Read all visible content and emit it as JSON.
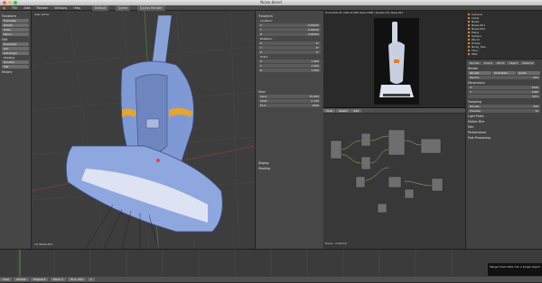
{
  "window": {
    "title": "Noise.blend"
  },
  "menubar": {
    "items": [
      "File",
      "Add",
      "Render",
      "Window",
      "Help"
    ],
    "layout": "Default",
    "scene": "Scene",
    "engine": "Cycles Render"
  },
  "viewport": {
    "label": "User Ortho",
    "object_label": "(1) Noise.001",
    "bottom_left": "Blender Render"
  },
  "toolshelf": {
    "transform_header": "Transform",
    "transform_buttons": [
      "Translate",
      "Rotate",
      "Scale",
      "Mirror"
    ],
    "edit_header": "Edit",
    "edit_buttons": [
      "Duplicate",
      "Join",
      "Set Origin",
      "Shading",
      "Smooth",
      "Flat"
    ],
    "history_header": "History"
  },
  "npanel": {
    "transform_header": "Transform",
    "fields": [
      "Location:",
      "X",
      "Y",
      "Z",
      "Rotation:",
      "X",
      "Y",
      "Z",
      "Scale:",
      "X",
      "Y",
      "Z",
      "Dimensions:",
      "X",
      "Y",
      "Z"
    ],
    "view_header": "View",
    "lens": "Lens:",
    "lens_value": "35.000",
    "clip_start": "0.100",
    "clip_end": "1000",
    "display_header": "Display",
    "shading_header": "Shading"
  },
  "render": {
    "info": "Time:00:01.87 | Mem:6.50M, Peak 6.85M | Sample 2/5 | Noise.001"
  },
  "nodeeditor": {
    "label": "Noise - material"
  },
  "outliner": {
    "items": [
      "Camera",
      "Lamp",
      "Noise",
      "Noise.001",
      "Noise.002",
      "Plane",
      "Sphere",
      "World",
      "Holder",
      "Node_Tree",
      "Floor",
      "Wall"
    ]
  },
  "properties": {
    "tabs": [
      "Render",
      "Scene",
      "World",
      "Object",
      "Material"
    ],
    "sections": [
      "Render",
      "Dimensions",
      "Sampling",
      "Light Paths",
      "Motion Blur",
      "Film",
      "Performance",
      "Post Processing"
    ],
    "buttons": [
      "Render",
      "Animation",
      "Audio"
    ],
    "device_label": "Device:",
    "device_value": "CPU"
  },
  "timeline": {
    "frame": "1",
    "start": "Start: 1",
    "end": "End: 250",
    "playback": "Playback"
  },
  "tooltip": {
    "text": "Merge mesh data into a single object"
  },
  "colors": {
    "orange": "#e87b2c",
    "blender_bg": "#3d3d3d"
  }
}
